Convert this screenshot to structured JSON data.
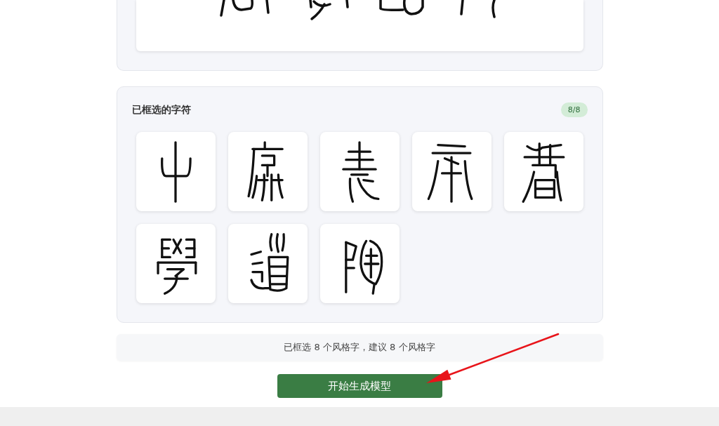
{
  "preview": {
    "kind": "image"
  },
  "selected_panel": {
    "title": "已框选的字符",
    "badge": "8/8",
    "glyphs": [
      {
        "kind": "image"
      },
      {
        "kind": "image"
      },
      {
        "kind": "image"
      },
      {
        "kind": "image"
      },
      {
        "kind": "image"
      },
      {
        "kind": "image"
      },
      {
        "kind": "image"
      },
      {
        "kind": "image"
      }
    ]
  },
  "summary": "已框选 8 个风格字，建议 8 个风格字",
  "primary_button": {
    "label": "开始生成模型"
  },
  "annotation": {
    "kind": "arrow"
  }
}
